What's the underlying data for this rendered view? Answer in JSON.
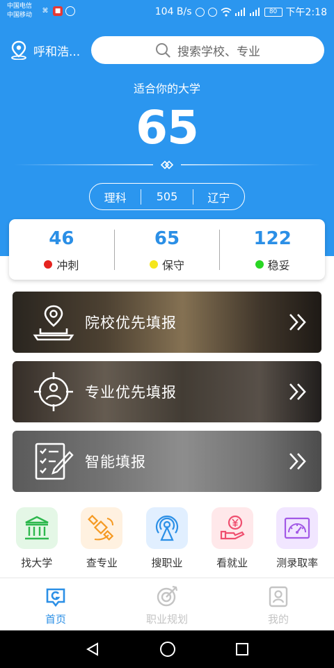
{
  "status_bar": {
    "carrier_1": "中国电信",
    "carrier_2": "中国移动",
    "net_speed": "104 B/s",
    "battery": "80",
    "time": "下午2:18"
  },
  "header": {
    "location": "呼和浩...",
    "search_placeholder": "搜索学校、专业"
  },
  "hero": {
    "label": "适合你的大学",
    "count": "65",
    "subject": "理科",
    "score": "505",
    "province": "辽宁"
  },
  "stats": [
    {
      "value": "46",
      "label": "冲刺",
      "dot_color": "#e5231f"
    },
    {
      "value": "65",
      "label": "保守",
      "dot_color": "#f5e61c"
    },
    {
      "value": "122",
      "label": "稳妥",
      "dot_color": "#29d623"
    }
  ],
  "banners": [
    {
      "label": "院校优先填报",
      "icon": "laptop-location-icon"
    },
    {
      "label": "专业优先填报",
      "icon": "target-person-icon"
    },
    {
      "label": "智能填报",
      "icon": "checklist-pen-icon"
    }
  ],
  "features": [
    {
      "label": "找大学",
      "icon": "university-icon",
      "bg": "#e4f7e6",
      "color": "#2db84d"
    },
    {
      "label": "查专业",
      "icon": "satellite-icon",
      "bg": "#fff1e0",
      "color": "#f59a23"
    },
    {
      "label": "搜职业",
      "icon": "broadcast-tower-icon",
      "bg": "#e1efff",
      "color": "#2b8fe6"
    },
    {
      "label": "看就业",
      "icon": "yuan-hand-icon",
      "bg": "#ffe8ea",
      "color": "#ef4f6f"
    },
    {
      "label": "测录取率",
      "icon": "gauge-icon",
      "bg": "#f1e6ff",
      "color": "#a259e6"
    }
  ],
  "tabbar": [
    {
      "label": "首页",
      "icon": "home-icon",
      "active": true
    },
    {
      "label": "职业规划",
      "icon": "career-icon",
      "active": false
    },
    {
      "label": "我的",
      "icon": "profile-icon",
      "active": false
    }
  ],
  "colors": {
    "primary": "#2b96ef",
    "accent_text": "#2b8fe6"
  }
}
